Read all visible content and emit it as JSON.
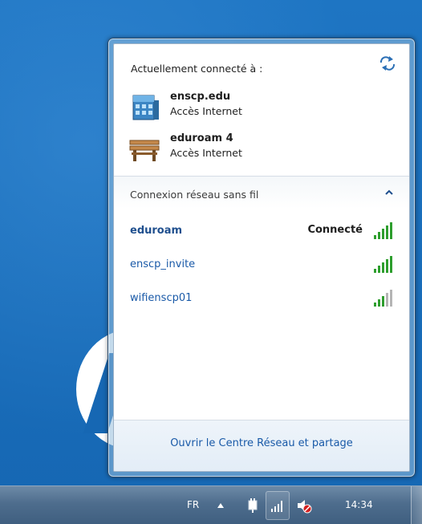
{
  "flyout": {
    "current_heading": "Actuellement connecté à :",
    "connections": [
      {
        "name": "enscp.edu",
        "status": "Accès Internet",
        "icon": "domain-network-icon"
      },
      {
        "name": "eduroam  4",
        "status": "Accès Internet",
        "icon": "public-network-bench-icon"
      }
    ],
    "wireless_section_title": "Connexion réseau sans fil",
    "networks": [
      {
        "name": "eduroam",
        "state": "Connecté",
        "signal_bars": 5
      },
      {
        "name": "enscp_invite",
        "state": "",
        "signal_bars": 5
      },
      {
        "name": "wifienscp01",
        "state": "",
        "signal_bars": 3
      }
    ],
    "footer_link": "Ouvrir le Centre Réseau et partage"
  },
  "taskbar": {
    "language": "FR",
    "time": "14:34"
  },
  "colors": {
    "link": "#1a5aa8",
    "signal_active": "#2e9e2e",
    "signal_inactive": "#b5b5b5",
    "desktop": "#1a6fbc",
    "taskbar": "#4e6d8d"
  }
}
